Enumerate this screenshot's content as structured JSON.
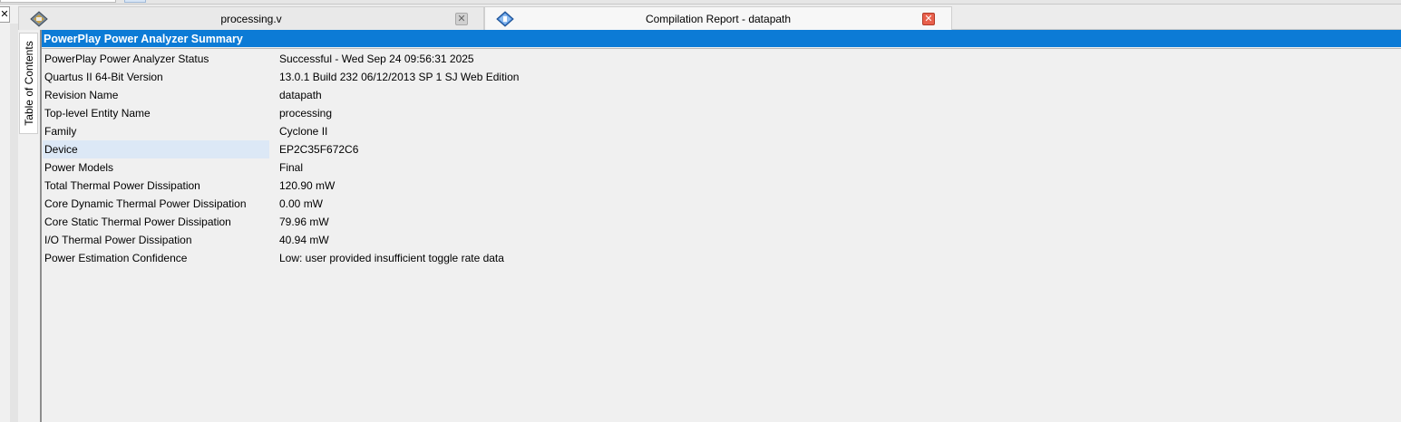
{
  "window": {
    "left_close_glyph": "✕"
  },
  "tabs": [
    {
      "label": "processing.v",
      "icon": "verilog-file-icon",
      "close_glyph": "✕",
      "active": false
    },
    {
      "label": "Compilation Report - datapath",
      "icon": "compilation-report-icon",
      "close_glyph": "✕",
      "active": true
    }
  ],
  "toc": {
    "label": "Table of Contents"
  },
  "report": {
    "title": "PowerPlay Power Analyzer Summary",
    "rows": [
      {
        "key": "PowerPlay Power Analyzer Status",
        "value": "Successful - Wed Sep 24 09:56:31 2025"
      },
      {
        "key": "Quartus II 64-Bit Version",
        "value": "13.0.1 Build 232 06/12/2013 SP 1 SJ Web Edition"
      },
      {
        "key": "Revision Name",
        "value": "datapath"
      },
      {
        "key": "Top-level Entity Name",
        "value": "processing"
      },
      {
        "key": "Family",
        "value": "Cyclone II"
      },
      {
        "key": "Device",
        "value": "EP2C35F672C6"
      },
      {
        "key": "Power Models",
        "value": "Final"
      },
      {
        "key": "Total Thermal Power Dissipation",
        "value": "120.90 mW"
      },
      {
        "key": "Core Dynamic Thermal Power Dissipation",
        "value": "0.00 mW"
      },
      {
        "key": "Core Static Thermal Power Dissipation",
        "value": "79.96 mW"
      },
      {
        "key": "I/O Thermal Power Dissipation",
        "value": "40.94 mW"
      },
      {
        "key": "Power Estimation Confidence",
        "value": "Low: user provided insufficient toggle rate data"
      }
    ]
  },
  "colors": {
    "header_bg": "#0c7bd6",
    "selected_cell": "#dce8f6",
    "close_red": "#e8604c"
  }
}
